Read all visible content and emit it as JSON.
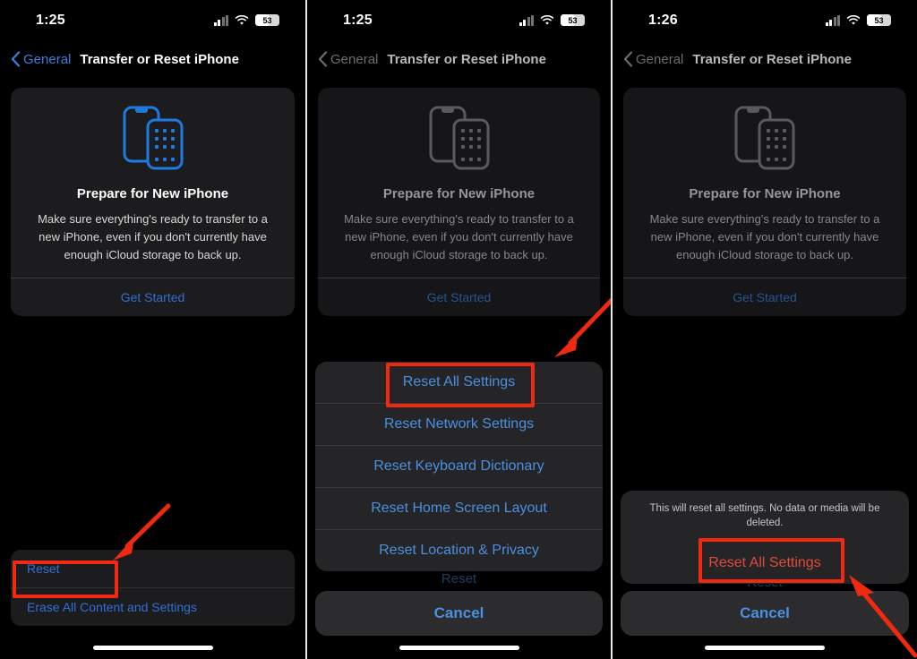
{
  "meta": {
    "accent_blue": "#2f6fd4",
    "sheet_blue": "#4a8fe0",
    "destructive_red": "#e04a3a",
    "annotation_red": "#ef2a10",
    "card_bg": "#1c1c1e",
    "screen_bg": "#000000"
  },
  "panels": [
    {
      "id": "panel-1",
      "status": {
        "time": "1:25",
        "battery_percent": "53",
        "wifi": "wifi-icon",
        "cellular": "cellular-signal-icon"
      },
      "nav": {
        "back_label": "General",
        "title": "Transfer or Reset iPhone",
        "back_icon": "chevron-left-icon"
      },
      "card": {
        "icon": "two-iphones-icon",
        "title": "Prepare for New iPhone",
        "body": "Make sure everything's ready to transfer to a new iPhone, even if you don't currently have enough iCloud storage to back up.",
        "action": "Get Started"
      },
      "settings_rows": [
        "Reset",
        "Erase All Content and Settings"
      ],
      "annotations": {
        "highlight_target": "Reset",
        "arrow": "down-left-arrow"
      }
    },
    {
      "id": "panel-2",
      "status": {
        "time": "1:25",
        "battery_percent": "53",
        "wifi": "wifi-icon",
        "cellular": "cellular-signal-icon"
      },
      "nav": {
        "back_label": "General",
        "title": "Transfer or Reset iPhone",
        "back_icon": "chevron-left-icon"
      },
      "card": {
        "icon": "two-iphones-icon",
        "title": "Prepare for New iPhone",
        "body": "Make sure everything's ready to transfer to a new iPhone, even if you don't currently have enough iCloud storage to back up.",
        "action": "Get Started"
      },
      "action_sheet": {
        "options": [
          "Reset All Settings",
          "Reset Network Settings",
          "Reset Keyboard Dictionary",
          "Reset Home Screen Layout",
          "Reset Location & Privacy"
        ],
        "obscured_row": "Reset",
        "cancel": "Cancel"
      },
      "annotations": {
        "highlight_target": "Reset All Settings",
        "arrow": "down-left-arrow"
      }
    },
    {
      "id": "panel-3",
      "status": {
        "time": "1:26",
        "battery_percent": "53",
        "wifi": "wifi-icon",
        "cellular": "cellular-signal-icon"
      },
      "nav": {
        "back_label": "General",
        "title": "Transfer or Reset iPhone",
        "back_icon": "chevron-left-icon"
      },
      "card": {
        "icon": "two-iphones-icon",
        "title": "Prepare for New iPhone",
        "body": "Make sure everything's ready to transfer to a new iPhone, even if you don't currently have enough iCloud storage to back up.",
        "action": "Get Started"
      },
      "confirm_sheet": {
        "message": "This will reset all settings. No data or media will be deleted.",
        "confirm": "Reset All Settings",
        "obscured_row": "Reset",
        "cancel": "Cancel"
      },
      "annotations": {
        "highlight_target": "Reset All Settings",
        "arrow": "up-left-arrow"
      }
    }
  ]
}
